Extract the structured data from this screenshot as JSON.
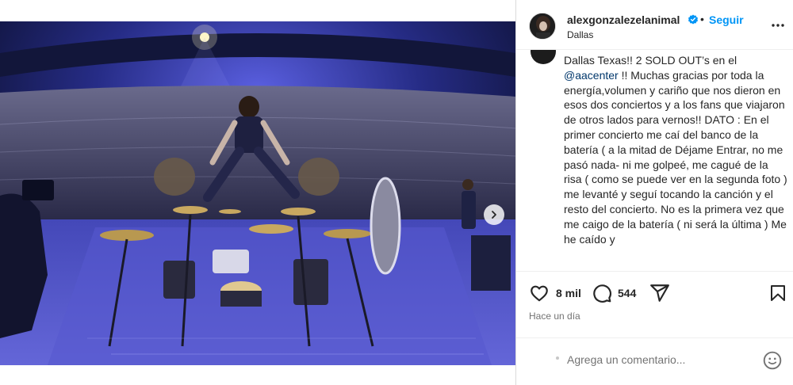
{
  "post": {
    "username": "alexgonzalezelanimal",
    "separator": "•",
    "follow_label": "Seguir",
    "location": "Dallas"
  },
  "caption": {
    "line1": "Dallas Texas!! 2 SOLD OUT’s  en el",
    "mention": "@aacenter",
    "line2_rest": " !! Muchas gracias por toda",
    "body": "la energía,volumen y cariño que nos dieron en esos dos conciertos y a los fans que viajaron de otros lados para vernos!! DATO : En el primer concierto me caí del banco de la batería ( a la mitad de Déjame Entrar, no me pasó nada- ni me golpeé, me cagué de la risa ( como se puede ver en la segunda foto ) me levanté y seguí tocando la canción y el resto del concierto. No es la primera vez que me caigo de la batería ( ni será la última ) Me he caído y"
  },
  "actions": {
    "likes": "8 mil",
    "comments": "544"
  },
  "timestamp": "Hace un día",
  "comment": {
    "placeholder": "Agrega un comentario..."
  },
  "icons": {
    "like": "heart-icon",
    "comment": "comment-bubble-icon",
    "share": "paper-plane-icon",
    "save": "bookmark-icon",
    "more": "more-options-icon",
    "next": "chevron-right-icon",
    "emoji": "emoji-icon",
    "verified": "verified-badge-icon"
  },
  "colors": {
    "accent": "#0095f6",
    "verified": "#0095f6",
    "mention": "#00376b",
    "muted": "#737373",
    "stage_light": "#4b4cc8"
  }
}
